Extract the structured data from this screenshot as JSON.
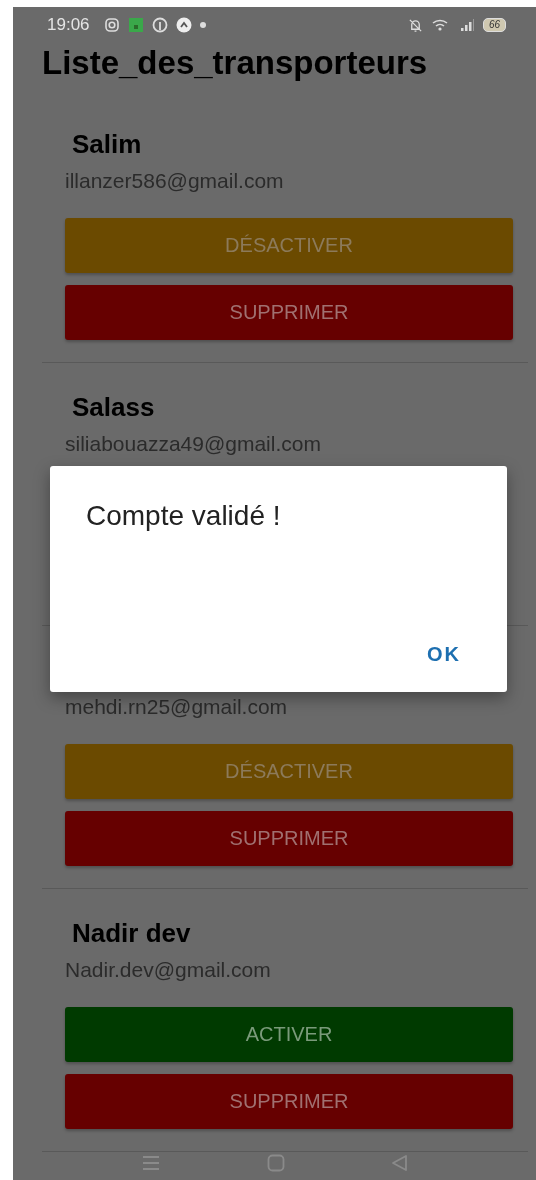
{
  "status_bar": {
    "time": "19:06",
    "battery": "66"
  },
  "title": "Liste_des_transporteurs",
  "transporters": [
    {
      "name": "Salim",
      "email": "illanzer586@gmail.com",
      "buttons": [
        {
          "kind": "deactivate",
          "label": "DÉSACTIVER"
        },
        {
          "kind": "delete",
          "label": "SUPPRIMER"
        }
      ]
    },
    {
      "name": "Salass",
      "email": "siliabouazza49@gmail.com"
    },
    {
      "email": "mehdi.rn25@gmail.com",
      "buttons": [
        {
          "kind": "deactivate",
          "label": "DÉSACTIVER"
        },
        {
          "kind": "delete",
          "label": "SUPPRIMER"
        }
      ]
    },
    {
      "name": "Nadir dev",
      "email": "Nadir.dev@gmail.com",
      "buttons": [
        {
          "kind": "activate",
          "label": "ACTIVER"
        },
        {
          "kind": "delete",
          "label": "SUPPRIMER"
        }
      ]
    }
  ],
  "dialog": {
    "message": "Compte validé !",
    "button": "OK"
  }
}
